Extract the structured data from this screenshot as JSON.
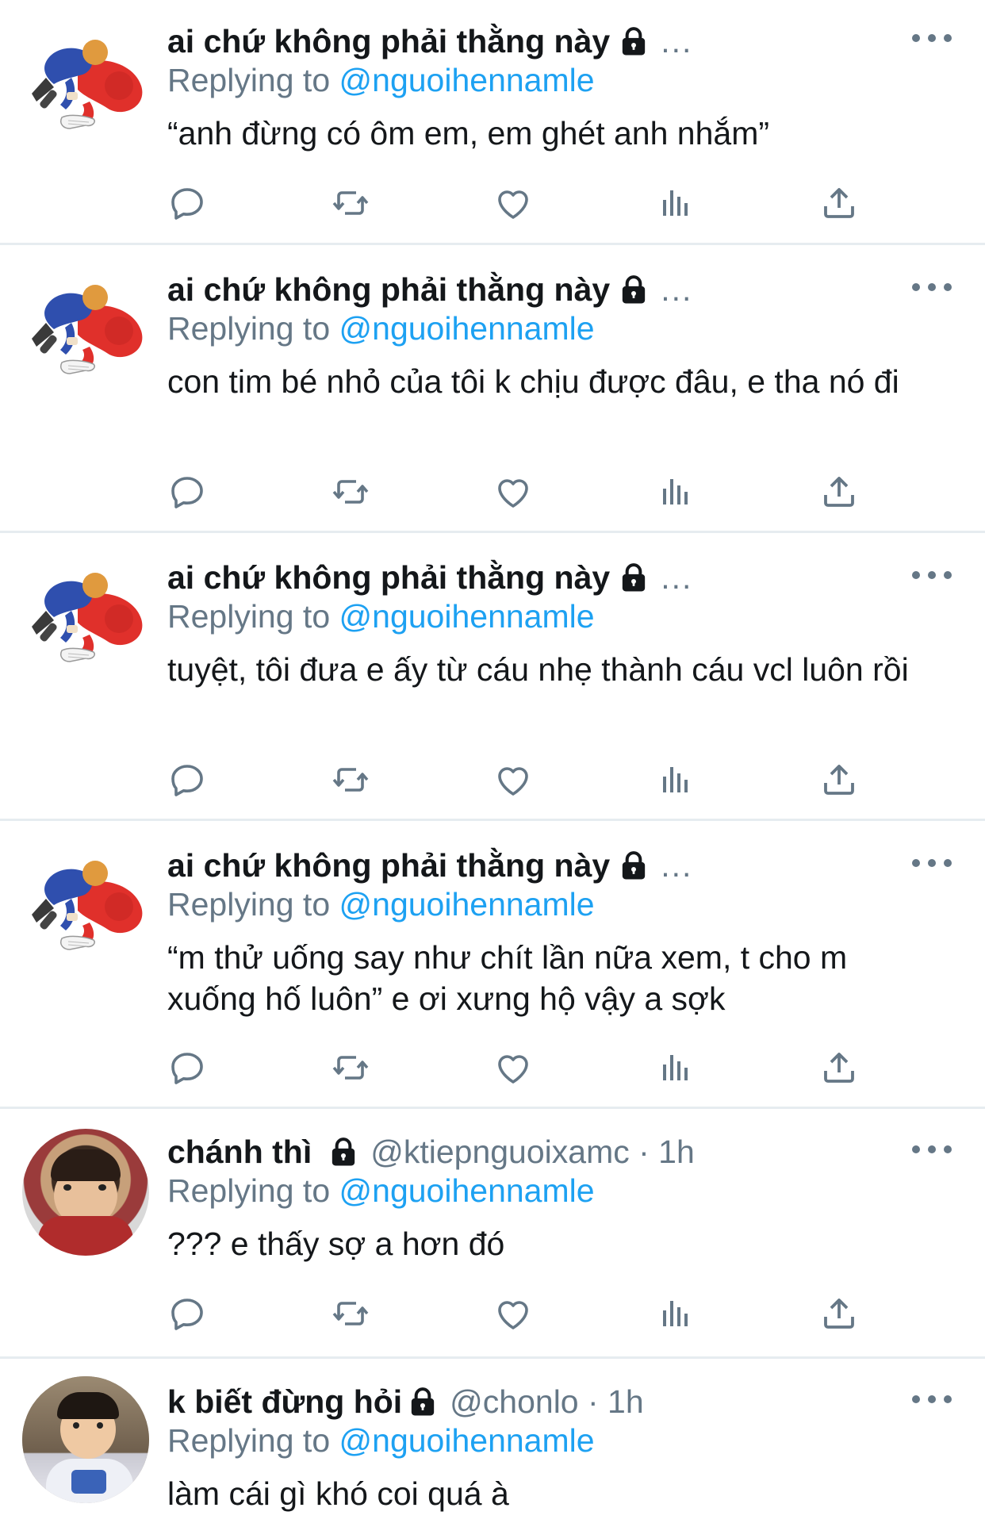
{
  "tweets": [
    {
      "name": "ai chứ không phải thằng này",
      "handle": "",
      "time": "",
      "overflow": "...",
      "replying_prefix": "Replying to",
      "replying_to": "@nguoihennamle",
      "text": "“anh đừng có ôm em, em ghét anh nhắm”",
      "avatar": "cartoon-figures-avatar"
    },
    {
      "name": "ai chứ không phải thằng này",
      "handle": "",
      "time": "",
      "overflow": "...",
      "replying_prefix": "Replying to",
      "replying_to": "@nguoihennamle",
      "text": "con tim bé nhỏ của tôi k chịu được đâu, e tha nó đi",
      "avatar": "cartoon-figures-avatar"
    },
    {
      "name": "ai chứ không phải thằng này",
      "handle": "",
      "time": "",
      "overflow": "...",
      "replying_prefix": "Replying to",
      "replying_to": "@nguoihennamle",
      "text": "tuyệt, tôi đưa e ấy từ cáu nhẹ thành cáu vcl luôn rồi",
      "avatar": "cartoon-figures-avatar"
    },
    {
      "name": "ai chứ không phải thằng này",
      "handle": "",
      "time": "",
      "overflow": "...",
      "replying_prefix": "Replying to",
      "replying_to": "@nguoihennamle",
      "text": "“m thử uống say như chít lần nữa xem, t cho m xuống hố luôn” e ơi xưng hộ vậy a sợk",
      "avatar": "cartoon-figures-avatar"
    },
    {
      "name": "chánh thì",
      "handle": "@ktiepnguoixamc · 1h",
      "time": "1h",
      "overflow": "",
      "replying_prefix": "Replying to",
      "replying_to": "@nguoihennamle",
      "text": "??? e thấy sợ a hơn đó",
      "avatar": "child-photo-avatar"
    },
    {
      "name": "k biết đừng hỏi",
      "handle": "@chonlo · 1h",
      "time": "1h",
      "overflow": "",
      "replying_prefix": "Replying to",
      "replying_to": "@nguoihennamle",
      "text": "làm cái gì khó coi quá à",
      "avatar": "boy-photo-avatar"
    }
  ],
  "icons": {
    "reply": "reply-icon",
    "retweet": "retweet-icon",
    "like": "like-icon",
    "analytics": "analytics-icon",
    "share": "share-icon",
    "lock": "lock-icon",
    "more": "more-icon"
  },
  "colors": {
    "text": "#14171a",
    "secondary": "#657786",
    "link": "#1da1f2",
    "divider": "#e6ecf0"
  }
}
